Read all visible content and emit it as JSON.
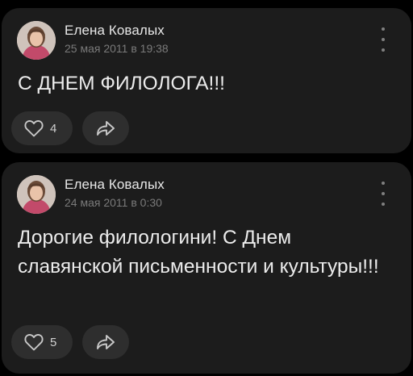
{
  "posts": [
    {
      "author": "Елена Ковалых",
      "date": "25 мая 2011 в 19:38",
      "text": "С ДНЕМ ФИЛОЛОГА!!!",
      "likes": "4"
    },
    {
      "author": "Елена Ковалых",
      "date": "24 мая 2011 в 0:30",
      "text": "Дорогие филологини! С Днем славянской письменности и культуры!!!",
      "likes": "5"
    }
  ],
  "icons": {
    "like": "heart-icon",
    "share": "share-arrow-icon",
    "menu": "more-vertical-icon"
  }
}
